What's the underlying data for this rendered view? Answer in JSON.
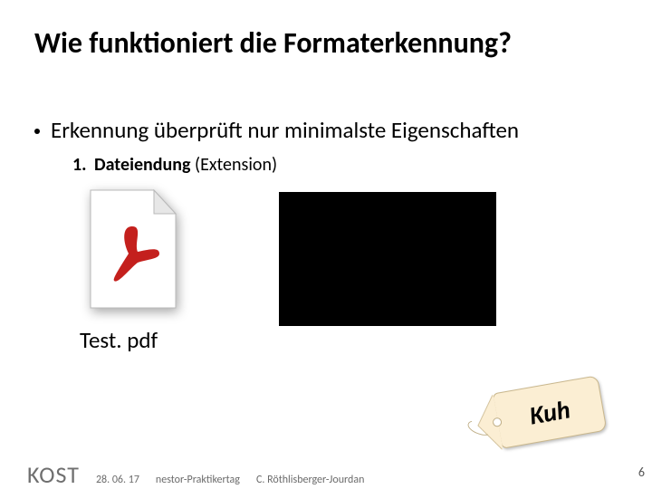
{
  "title": "Wie funktioniert die Formaterkennung?",
  "bullet": "Erkennung überprüft nur minimalste Eigenschaften",
  "numbered": {
    "num": "1.",
    "strong": "Dateiendung",
    "weak": "(Extension)"
  },
  "filename": "Test. pdf",
  "tag_label": "Kuh",
  "icons": {
    "pdf": "pdf-file-icon"
  },
  "footer": {
    "org": "KOST",
    "date": "28. 06. 17",
    "event": "nestor-Praktikertag",
    "author": "C. Röthlisberger-Jourdan",
    "page": "6"
  }
}
